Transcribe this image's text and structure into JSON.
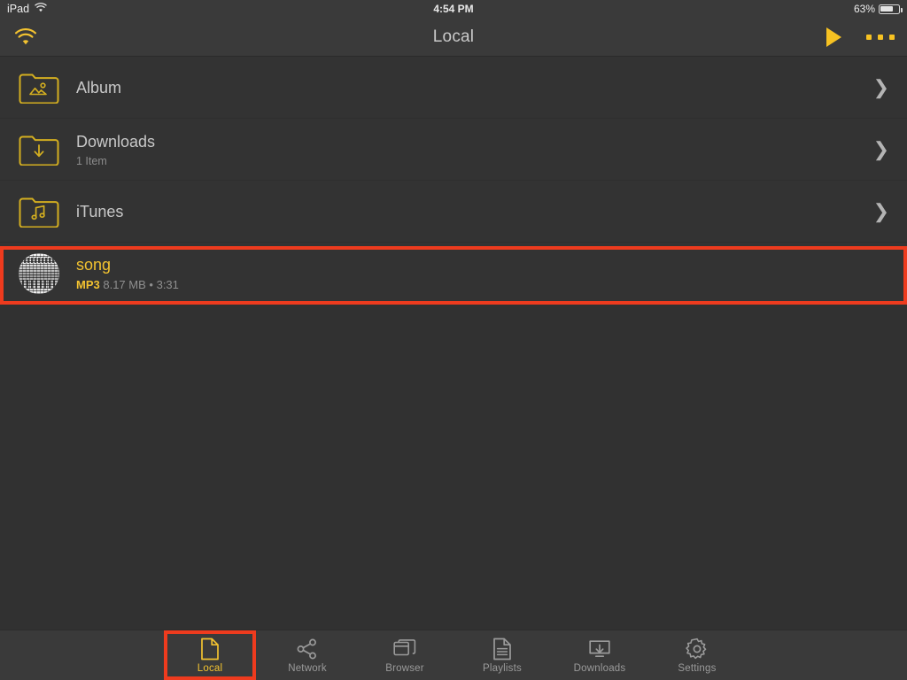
{
  "status_bar": {
    "device": "iPad",
    "wifi_icon": "wifi-icon",
    "time": "4:54 PM",
    "battery_percent": "63%",
    "battery_icon": "battery-icon"
  },
  "nav_bar": {
    "wifi_icon": "wifi-icon",
    "title": "Local",
    "play_icon": "play-icon",
    "more_icon": "more-options-icon"
  },
  "list": {
    "items": [
      {
        "title": "Album",
        "subtitle": "",
        "icon": "folder-photo-icon",
        "accessory": "chevron-right-icon",
        "type": "folder"
      },
      {
        "title": "Downloads",
        "subtitle": "1 Item",
        "icon": "folder-download-icon",
        "accessory": "chevron-right-icon",
        "type": "folder"
      },
      {
        "title": "iTunes",
        "subtitle": "",
        "icon": "folder-music-icon",
        "accessory": "chevron-right-icon",
        "type": "folder"
      }
    ],
    "song": {
      "title": "song",
      "format": "MP3",
      "size": "8.17 MB",
      "separator": "•",
      "duration": "3:31",
      "icon": "album-art-thumbnail",
      "selected": true
    }
  },
  "tab_bar": {
    "tabs": [
      {
        "label": "Local",
        "icon": "document-icon",
        "active": true
      },
      {
        "label": "Network",
        "icon": "share-icon",
        "active": false
      },
      {
        "label": "Browser",
        "icon": "windows-icon",
        "active": false
      },
      {
        "label": "Playlists",
        "icon": "list-doc-icon",
        "active": false
      },
      {
        "label": "Downloads",
        "icon": "download-icon",
        "active": false
      },
      {
        "label": "Settings",
        "icon": "gear-icon",
        "active": false
      }
    ]
  },
  "colors": {
    "accent": "#F2C230",
    "highlight": "#ee3b1e",
    "background": "#313131",
    "bar_background": "#3a3a3a",
    "text_primary": "#c8c8c8",
    "text_secondary": "#8c8c8c"
  }
}
